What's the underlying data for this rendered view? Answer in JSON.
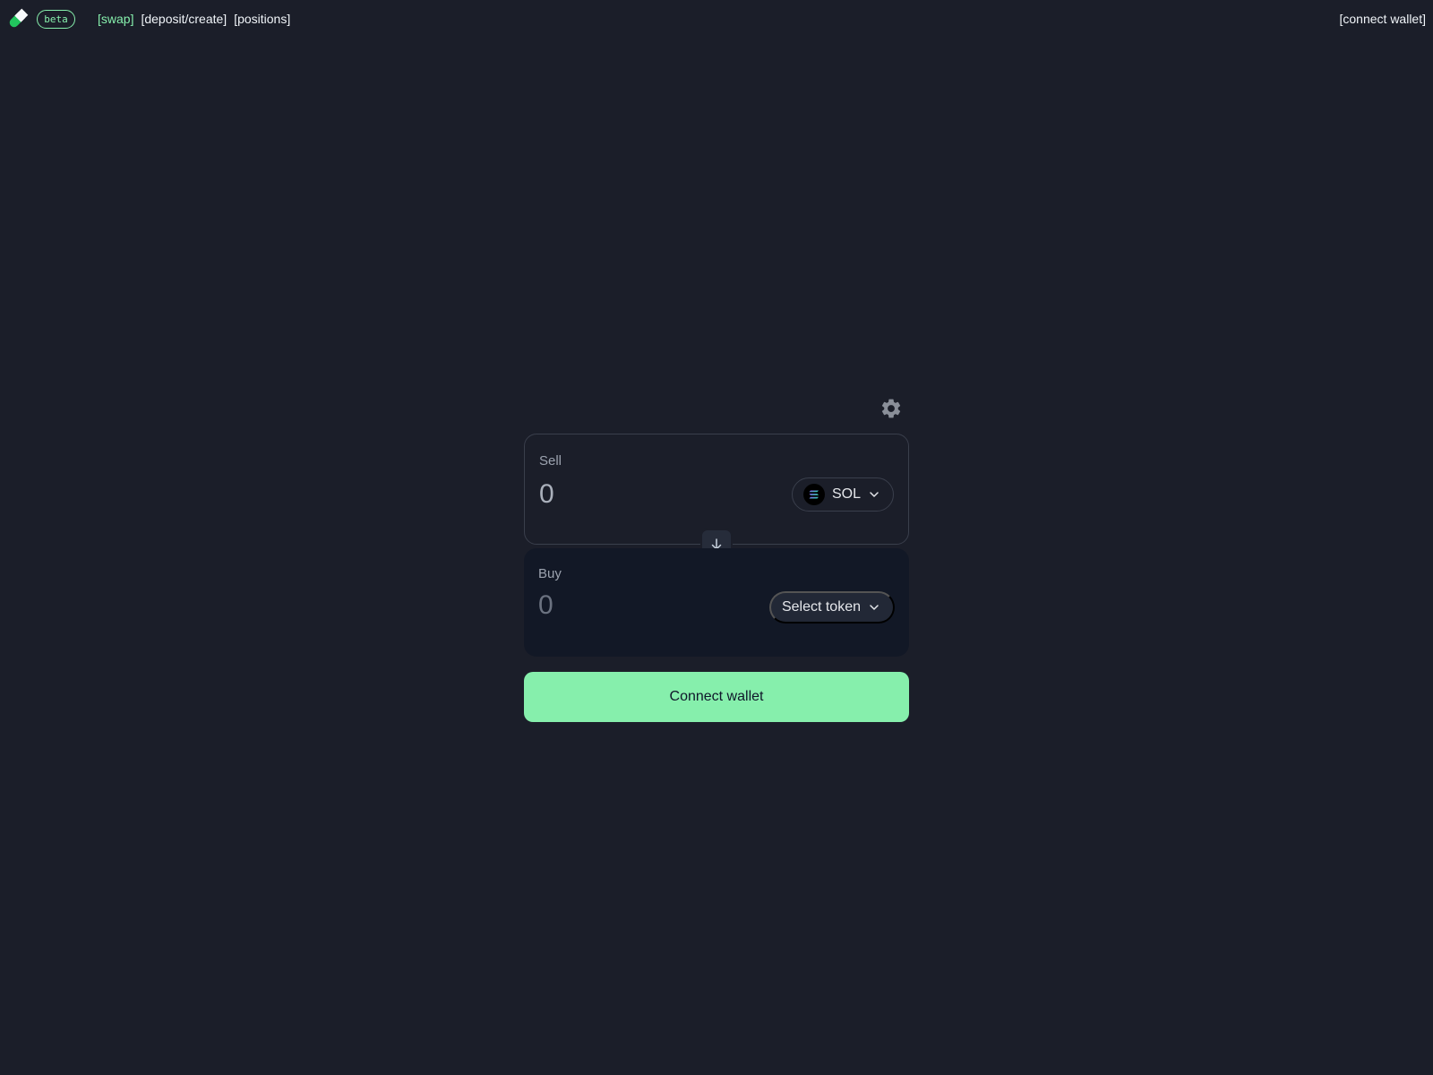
{
  "header": {
    "beta_label": "beta",
    "nav": [
      {
        "label": "[swap]",
        "active": true
      },
      {
        "label": "[deposit/create]",
        "active": false
      },
      {
        "label": "[positions]",
        "active": false
      }
    ],
    "connect_label": "[connect wallet]"
  },
  "swap": {
    "sell": {
      "label": "Sell",
      "amount": "0",
      "token": "SOL",
      "token_icon": "solana-icon"
    },
    "buy": {
      "label": "Buy",
      "amount": "0",
      "token_label": "Select token"
    },
    "settings_icon": "gear-icon",
    "switch_icon": "arrow-down-icon",
    "connect_label": "Connect wallet"
  },
  "colors": {
    "background": "#1b1e29",
    "accent": "#86efac",
    "buy_panel": "#121826",
    "border": "#3a3f4c"
  }
}
